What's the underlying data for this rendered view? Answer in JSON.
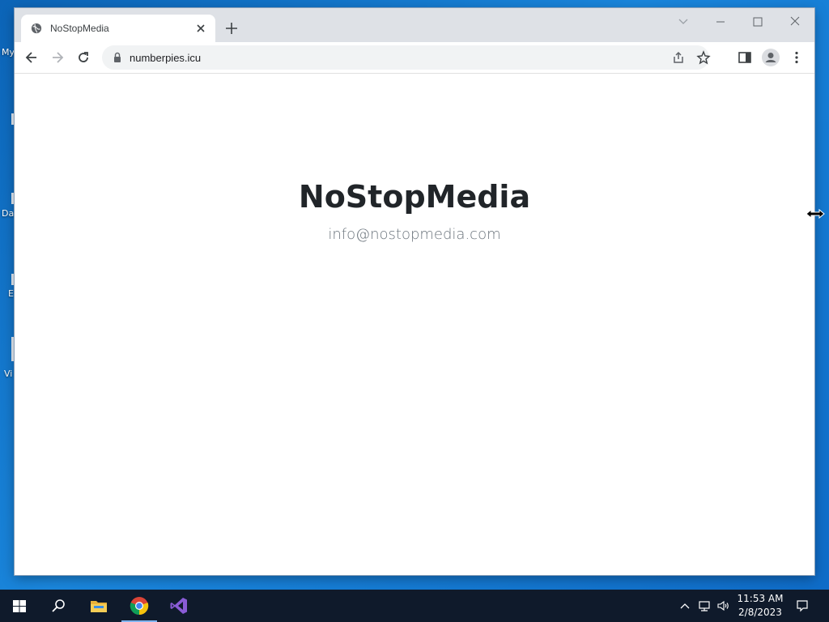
{
  "desktop": {
    "labels": [
      "My",
      "Da",
      "E",
      "Vi"
    ]
  },
  "browser": {
    "tab": {
      "title": "NoStopMedia",
      "favicon": "globe-icon"
    },
    "address_bar": {
      "url": "numberpies.icu"
    }
  },
  "page": {
    "heading": "NoStopMedia",
    "email": "info@nostopmedia.com"
  },
  "taskbar": {
    "apps": [
      "start",
      "search",
      "file-explorer",
      "chrome",
      "visual-studio"
    ],
    "clock": {
      "time": "11:53 AM",
      "date": "2/8/2023"
    }
  },
  "colors": {
    "titlebar": "#dee1e6",
    "taskbar": "#0f1a2b",
    "heading": "#212529",
    "email": "#6c757d"
  }
}
